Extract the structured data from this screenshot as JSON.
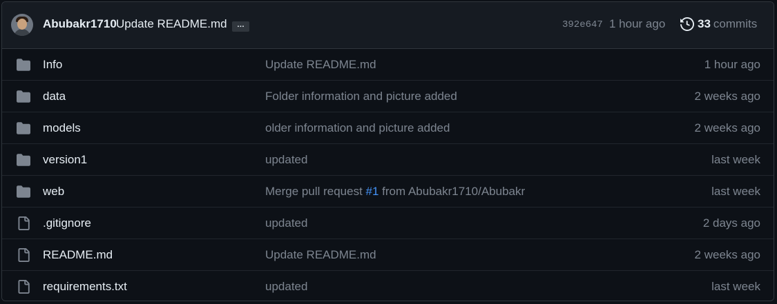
{
  "header": {
    "author": "Abubakr1710",
    "commit_message": "Update README.md",
    "ellipsis": "…",
    "sha": "392e647",
    "time": "1 hour ago",
    "commit_count": "33",
    "commits_label": "commits"
  },
  "files": [
    {
      "type": "folder",
      "icon": "folder-icon",
      "name": "Info",
      "message": "Update README.md",
      "time": "1 hour ago"
    },
    {
      "type": "folder",
      "icon": "folder-icon",
      "name": "data",
      "message": "Folder information and picture added",
      "time": "2 weeks ago"
    },
    {
      "type": "folder",
      "icon": "folder-icon",
      "name": "models",
      "message": "older information and picture added",
      "time": "2 weeks ago"
    },
    {
      "type": "folder",
      "icon": "folder-icon",
      "name": "version1",
      "message": "updated",
      "time": "last week"
    },
    {
      "type": "folder",
      "icon": "folder-icon",
      "name": "web",
      "message_prefix": "Merge pull request ",
      "pr_link": "#1",
      "message_suffix": " from Abubakr1710/Abubakr",
      "time": "last week"
    },
    {
      "type": "file",
      "icon": "file-icon",
      "name": ".gitignore",
      "message": "updated",
      "time": "2 days ago"
    },
    {
      "type": "file",
      "icon": "file-icon",
      "name": "README.md",
      "message": "Update README.md",
      "time": "2 weeks ago"
    },
    {
      "type": "file",
      "icon": "file-icon",
      "name": "requirements.txt",
      "message": "updated",
      "time": "last week"
    }
  ],
  "colors": {
    "background": "#0d1117",
    "header_background": "#161b22",
    "border": "#30363d",
    "muted_text": "#7d8590",
    "link": "#4493f8",
    "icon": "#7d8590"
  }
}
